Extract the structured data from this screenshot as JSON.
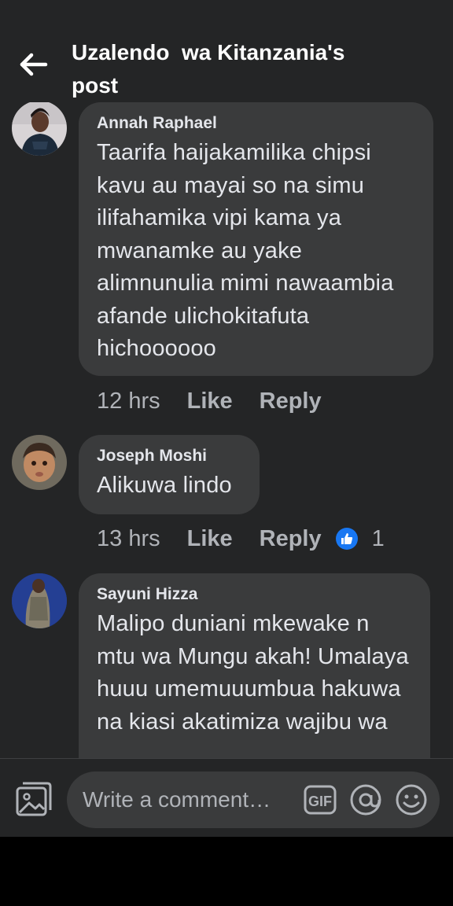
{
  "header": {
    "title": "Uzalendo  wa Kitanzania's\npost"
  },
  "comments": [
    {
      "author": "Annah Raphael",
      "text": "Taarifa haijakamilika chipsi kavu au mayai so na simu ilifahamika vipi kama ya mwanamke au yake alimnunulia mimi nawaambia afande ulichokitafuta hichoooooo",
      "time": "12 hrs",
      "like_label": "Like",
      "reply_label": "Reply"
    },
    {
      "author": "Joseph Moshi",
      "text": "Alikuwa lindo",
      "time": "13 hrs",
      "like_label": "Like",
      "reply_label": "Reply",
      "reaction_count": "1",
      "reaction_icon": "thumbs-up-icon"
    },
    {
      "author": "Sayuni Hizza",
      "text": "Malipo duniani mkewake n mtu wa Mungu akah! Umalaya huuu umemuuumbua hakuwa na kiasi akatimiza wajibu wa"
    }
  ],
  "composer": {
    "placeholder": "Write a comment…",
    "gallery_icon": "photo-gallery-icon",
    "gif_icon": "gif-icon",
    "at_icon": "mention-icon",
    "emoji_icon": "emoji-icon"
  },
  "colors": {
    "background": "#242526",
    "bubble": "#3a3b3c",
    "text": "#e4e6eb",
    "muted": "#b0b3b8",
    "accent": "#1877f2"
  }
}
